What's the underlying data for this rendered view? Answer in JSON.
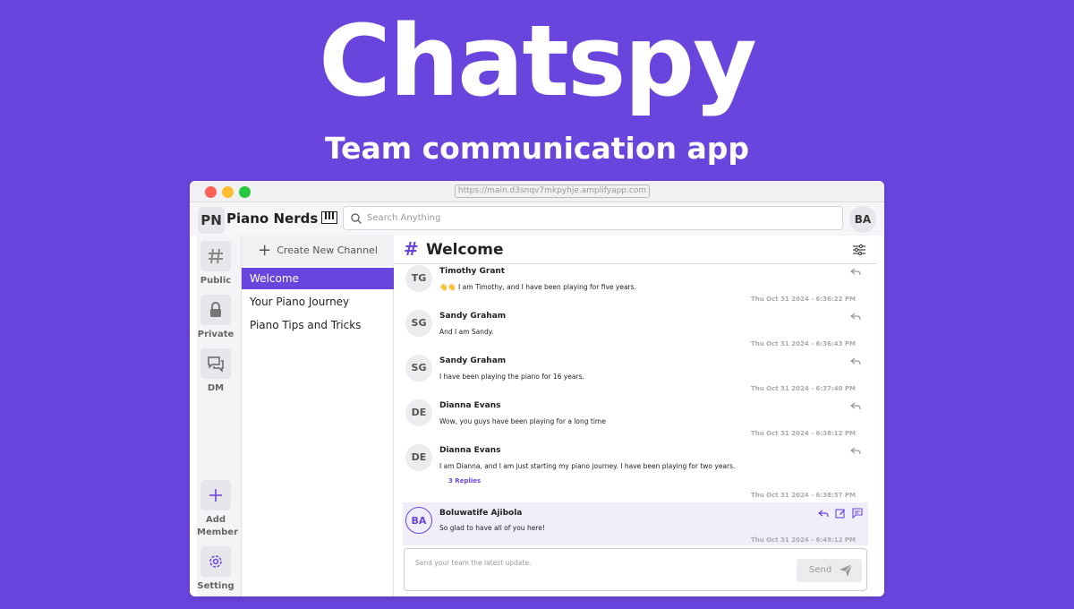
{
  "hero": {
    "title": "Chatspy",
    "subtitle": "Team communication app"
  },
  "browser": {
    "url": "https://main.d3snqv7mkpyhje.amplifyapp.com"
  },
  "workspace": {
    "initials": "PN",
    "name": "Piano Nerds",
    "emoji_icon": "piano-keyboard-icon"
  },
  "search": {
    "placeholder": "Search Anything"
  },
  "user": {
    "initials": "BA"
  },
  "rail": {
    "public": "Public",
    "private": "Private",
    "dm": "DM",
    "add_member": "Add Member",
    "setting": "Setting"
  },
  "channels": {
    "create_label": "Create New Channel",
    "items": [
      {
        "label": "Welcome",
        "active": true
      },
      {
        "label": "Your Piano Journey",
        "active": false
      },
      {
        "label": "Piano Tips and Tricks",
        "active": false
      }
    ]
  },
  "channel": {
    "hash": "#",
    "title": "Welcome"
  },
  "messages": [
    {
      "initials": "TG",
      "name": "Timothy Grant",
      "text": "👋👋 I am Timothy, and I have been playing for five years.",
      "time": "Thu Oct 31 2024 - 6:36:22 PM"
    },
    {
      "initials": "SG",
      "name": "Sandy Graham",
      "text": "And I am Sandy.",
      "time": "Thu Oct 31 2024 - 6:36:43 PM"
    },
    {
      "initials": "SG",
      "name": "Sandy Graham",
      "text": "I have been playing the piano for 16 years.",
      "time": "Thu Oct 31 2024 - 6:37:40 PM"
    },
    {
      "initials": "DE",
      "name": "Dianna Evans",
      "text": "Wow, you guys have been playing for a long time",
      "time": "Thu Oct 31 2024 - 6:38:12 PM"
    },
    {
      "initials": "DE",
      "name": "Dianna Evans",
      "text": "I am Dianna, and I am just starting my piano journey. I have been playing for two years.",
      "replies": "3 Replies",
      "time": "Thu Oct 31 2024 - 6:38:57 PM"
    },
    {
      "initials": "BA",
      "name": "Boluwatife Ajibola",
      "text": "So glad to have all of you here!",
      "time": "Thu Oct 31 2024 - 6:49:12 PM"
    }
  ],
  "composer": {
    "placeholder": "Send your team the latest update.",
    "send_label": "Send"
  },
  "colors": {
    "background": "#6a45dd",
    "accent": "#6a45dd",
    "highlight": "#f1eefc"
  }
}
